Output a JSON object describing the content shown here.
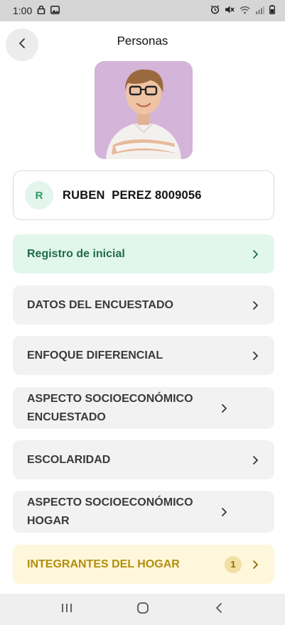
{
  "status_bar": {
    "time": "1:00",
    "left_icons": [
      "lock-icon",
      "image-icon"
    ],
    "right_icons": [
      "alarm-icon",
      "mute-icon",
      "wifi-icon",
      "signal-icon",
      "battery-icon"
    ]
  },
  "header": {
    "title": "Personas",
    "back_icon": "chevron-left-icon"
  },
  "person": {
    "initial": "R",
    "name": "RUBEN  PEREZ 8009056",
    "photo": "child-portrait-photo"
  },
  "menu": {
    "items": [
      {
        "label": "Registro de inicial",
        "style": "green"
      },
      {
        "label": "DATOS DEL ENCUESTADO",
        "style": "default"
      },
      {
        "label": "ENFOQUE DIFERENCIAL",
        "style": "default"
      },
      {
        "label": "ASPECTO SOCIOECONÓMICO ENCUESTADO",
        "style": "default"
      },
      {
        "label": "ESCOLARIDAD",
        "style": "default"
      },
      {
        "label": "ASPECTO SOCIOECONÓMICO HOGAR",
        "style": "default"
      },
      {
        "label": "INTEGRANTES DEL HOGAR",
        "style": "yellow",
        "badge": "1"
      }
    ]
  },
  "colors": {
    "accent_green": "#2e9a64",
    "green_bg": "#e1f7ec",
    "yellow_bg": "#fff7dc",
    "yellow_text": "#b28d0c"
  },
  "nav_bar": {
    "buttons": [
      "recent-apps-icon",
      "home-icon",
      "back-icon"
    ]
  }
}
